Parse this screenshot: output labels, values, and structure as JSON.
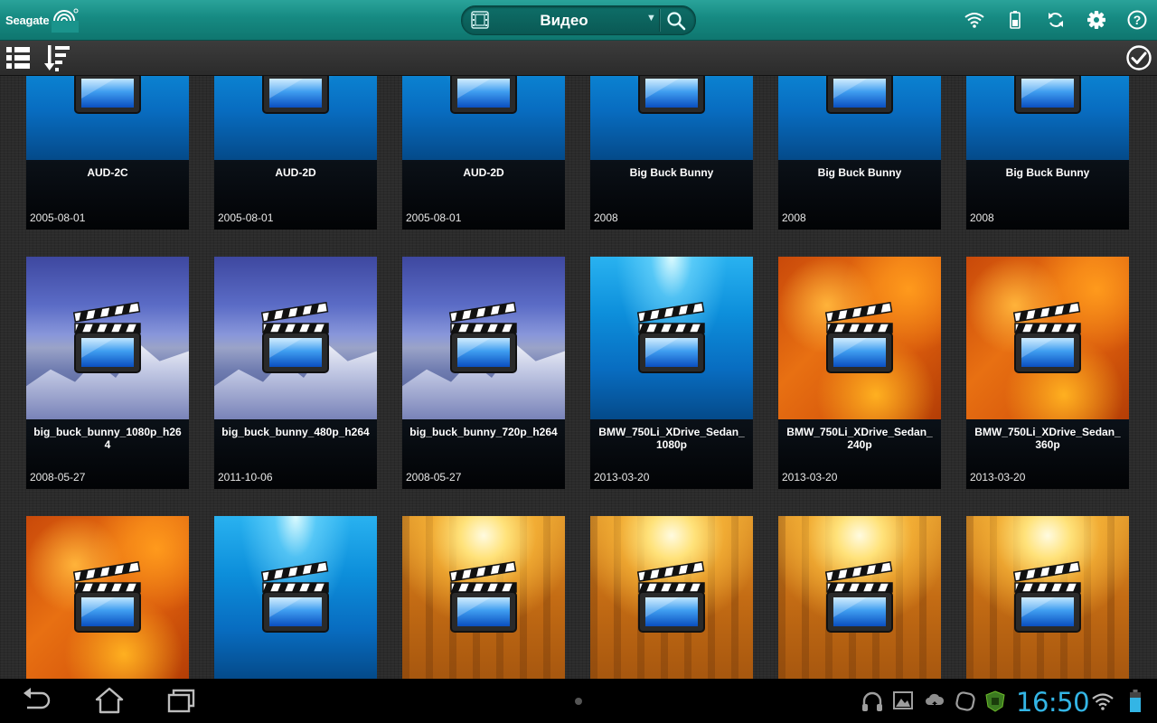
{
  "app": {
    "brand": "Seagate",
    "category_selector": {
      "label": "Видео",
      "icon": "film-icon"
    },
    "top_icons": [
      "wifi-icon",
      "battery-icon",
      "sync-icon",
      "settings-icon",
      "help-icon"
    ]
  },
  "toolbar": {
    "left": [
      "list-view-icon",
      "sort-icon"
    ],
    "right": [
      "select-mode-icon"
    ]
  },
  "grid": {
    "items": [
      {
        "title": "AUD-2C",
        "date": "2005-08-01",
        "bg": "ocean"
      },
      {
        "title": "AUD-2D",
        "date": "2005-08-01",
        "bg": "ocean"
      },
      {
        "title": "AUD-2D",
        "date": "2005-08-01",
        "bg": "ocean"
      },
      {
        "title": "Big Buck Bunny",
        "date": "2008",
        "bg": "ocean"
      },
      {
        "title": "Big Buck Bunny",
        "date": "2008",
        "bg": "ocean"
      },
      {
        "title": "Big Buck Bunny",
        "date": "2008",
        "bg": "ocean"
      },
      {
        "title": "big_buck_bunny_1080p_h264",
        "date": "2008-05-27",
        "bg": "mountain"
      },
      {
        "title": "big_buck_bunny_480p_h264",
        "date": "2011-10-06",
        "bg": "mountain"
      },
      {
        "title": "big_buck_bunny_720p_h264",
        "date": "2008-05-27",
        "bg": "mountain"
      },
      {
        "title": "BMW_750Li_XDrive_Sedan_1080p",
        "date": "2013-03-20",
        "bg": "ocean"
      },
      {
        "title": "BMW_750Li_XDrive_Sedan_240p",
        "date": "2013-03-20",
        "bg": "autumn"
      },
      {
        "title": "BMW_750Li_XDrive_Sedan_360p",
        "date": "2013-03-20",
        "bg": "autumn"
      },
      {
        "title": "",
        "date": "",
        "bg": "autumn"
      },
      {
        "title": "",
        "date": "",
        "bg": "ocean"
      },
      {
        "title": "",
        "date": "",
        "bg": "forest"
      },
      {
        "title": "",
        "date": "",
        "bg": "forest"
      },
      {
        "title": "",
        "date": "",
        "bg": "forest"
      },
      {
        "title": "",
        "date": "",
        "bg": "forest"
      }
    ]
  },
  "system_bar": {
    "clock": "16:50",
    "nav": [
      "back-icon",
      "home-icon",
      "recent-apps-icon"
    ],
    "notifications": [
      "headset-icon",
      "gallery-icon",
      "cloud-icon",
      "app-icon",
      "security-icon"
    ],
    "status": [
      "wifi-icon",
      "battery-icon"
    ],
    "accent": "#33b5e5"
  }
}
